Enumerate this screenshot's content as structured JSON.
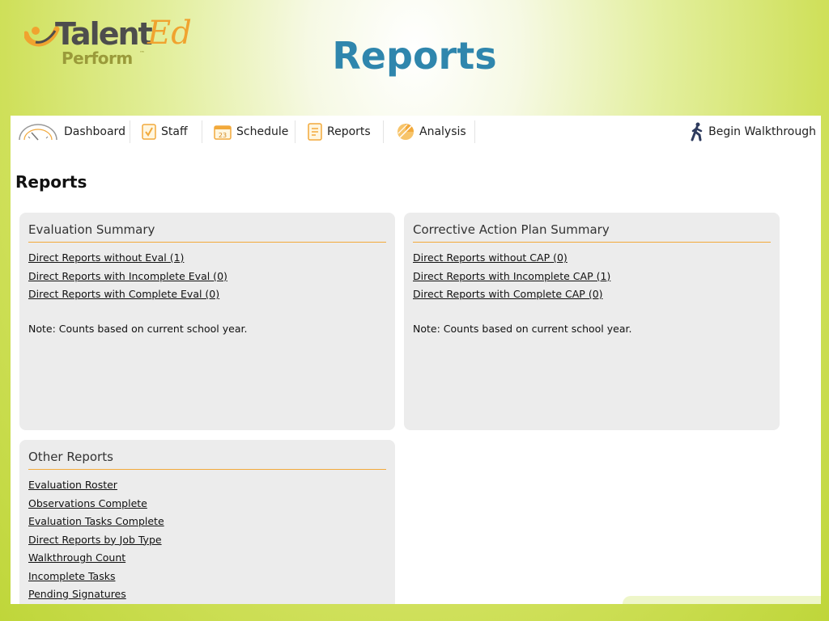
{
  "logo": {
    "brand_main": "Talent",
    "brand_accent": "Ed",
    "brand_sub": "Perform",
    "brand_tm": "™"
  },
  "slide": {
    "title": "Reports"
  },
  "nav": {
    "items": [
      {
        "label": "Dashboard",
        "icon": "gauge-icon"
      },
      {
        "label": "Staff",
        "icon": "checkbox-icon"
      },
      {
        "label": "Schedule",
        "icon": "calendar-icon"
      },
      {
        "label": "Reports",
        "icon": "report-icon"
      },
      {
        "label": "Analysis",
        "icon": "pie-chart-icon"
      }
    ],
    "calendar_day": "23",
    "walkthrough": {
      "label": "Begin Walkthrough",
      "icon": "walking-person-icon"
    }
  },
  "page": {
    "title": "Reports"
  },
  "evaluation_summary": {
    "title": "Evaluation Summary",
    "links": [
      "Direct Reports without Eval (1)",
      "Direct Reports with Incomplete Eval (0)",
      "Direct Reports with Complete Eval (0)"
    ],
    "note": "Note: Counts based on current school year."
  },
  "cap_summary": {
    "title": "Corrective Action Plan Summary",
    "links": [
      "Direct Reports without CAP (0)",
      "Direct Reports with Incomplete CAP (1)",
      "Direct Reports with Complete CAP (0)"
    ],
    "note": "Note: Counts based on current school year."
  },
  "other_reports": {
    "title": "Other Reports",
    "links": [
      "Evaluation Roster",
      "Observations Complete",
      "Evaluation Tasks Complete",
      "Direct Reports by Job Type",
      "Walkthrough Count",
      "Incomplete Tasks",
      "Pending Signatures"
    ]
  },
  "colors": {
    "accent_orange": "#f2a93b",
    "title_blue": "#2f86ad",
    "panel_gray": "#ececec",
    "lime": "#c4d940"
  }
}
